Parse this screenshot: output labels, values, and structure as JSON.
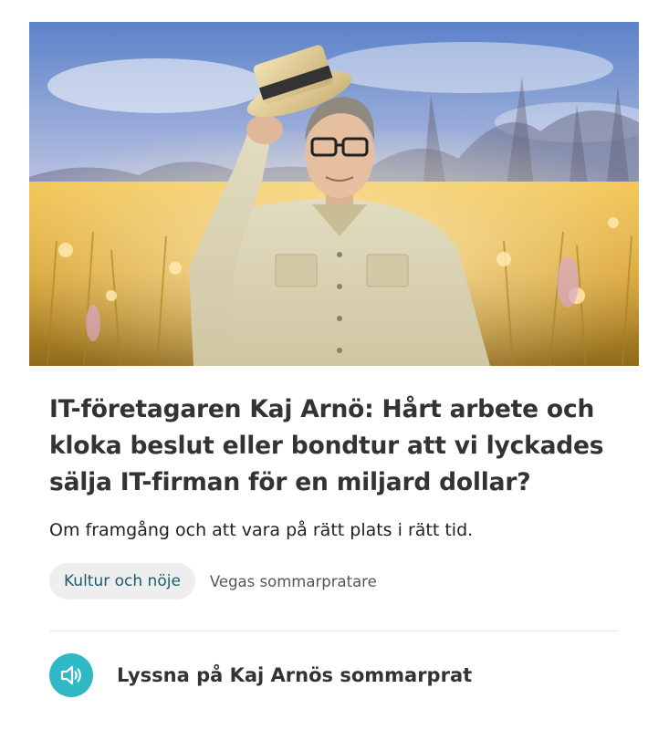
{
  "article": {
    "image_subject": "man-in-hat-in-meadow",
    "title": "IT-företagaren Kaj Arnö: Hårt arbete och kloka beslut eller bondtur att vi lyckades sälja IT-firman för en miljard dollar?",
    "preamble": "Om framgång och att vara på rätt plats i rätt tid.",
    "tags": {
      "category": "Kultur och nöje",
      "series": "Vegas sommarpratare"
    },
    "listen": {
      "icon": "speaker-icon",
      "label": "Lyssna på Kaj Arnös sommarprat"
    }
  },
  "colors": {
    "accent": "#2fb8c5",
    "tag_text": "#1b5e6b",
    "tag_bg": "#eeeeee",
    "title": "#333333"
  }
}
